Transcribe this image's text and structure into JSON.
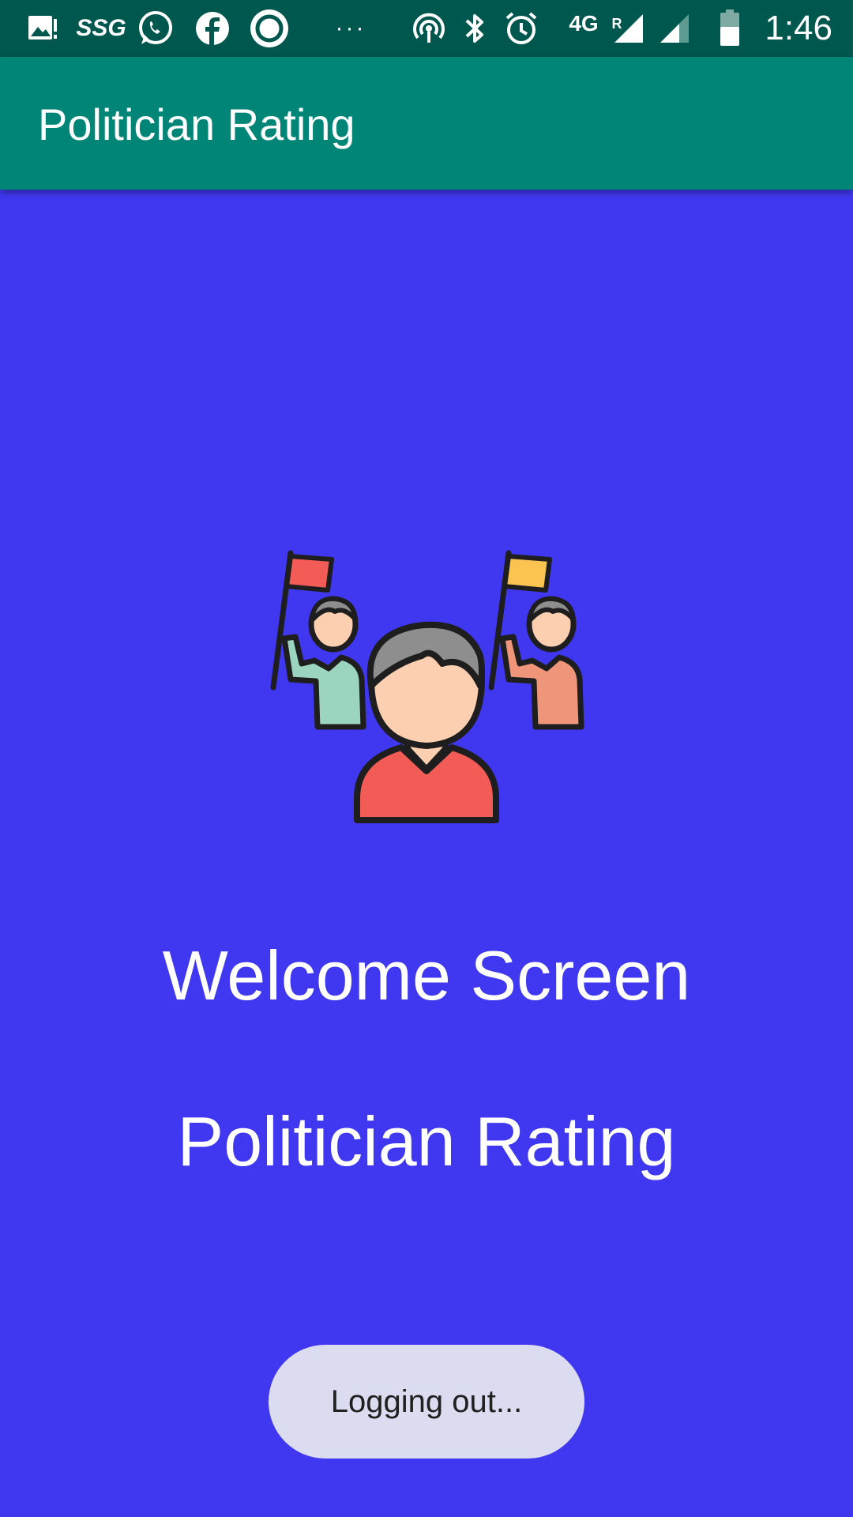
{
  "status_bar": {
    "icons": [
      "gallery-icon",
      "ssg-icon",
      "whatsapp-icon",
      "facebook-icon",
      "app-ring-icon",
      "more-icon",
      "hotspot-icon",
      "bluetooth-icon",
      "alarm-icon",
      "signal-icon",
      "signal-2-icon",
      "battery-icon"
    ],
    "ssg_label": "SSG",
    "network_label": "4G",
    "roaming_label": "R",
    "time": "1:46",
    "background_color": "#00574d"
  },
  "app_bar": {
    "title": "Politician Rating",
    "color": "#008577"
  },
  "main": {
    "background_color": "#4038f0",
    "illustration": "politician-supporters-illustration",
    "welcome_text": "Welcome Screen",
    "app_name_text": "Politician Rating"
  },
  "toast": {
    "message": "Logging out..."
  }
}
